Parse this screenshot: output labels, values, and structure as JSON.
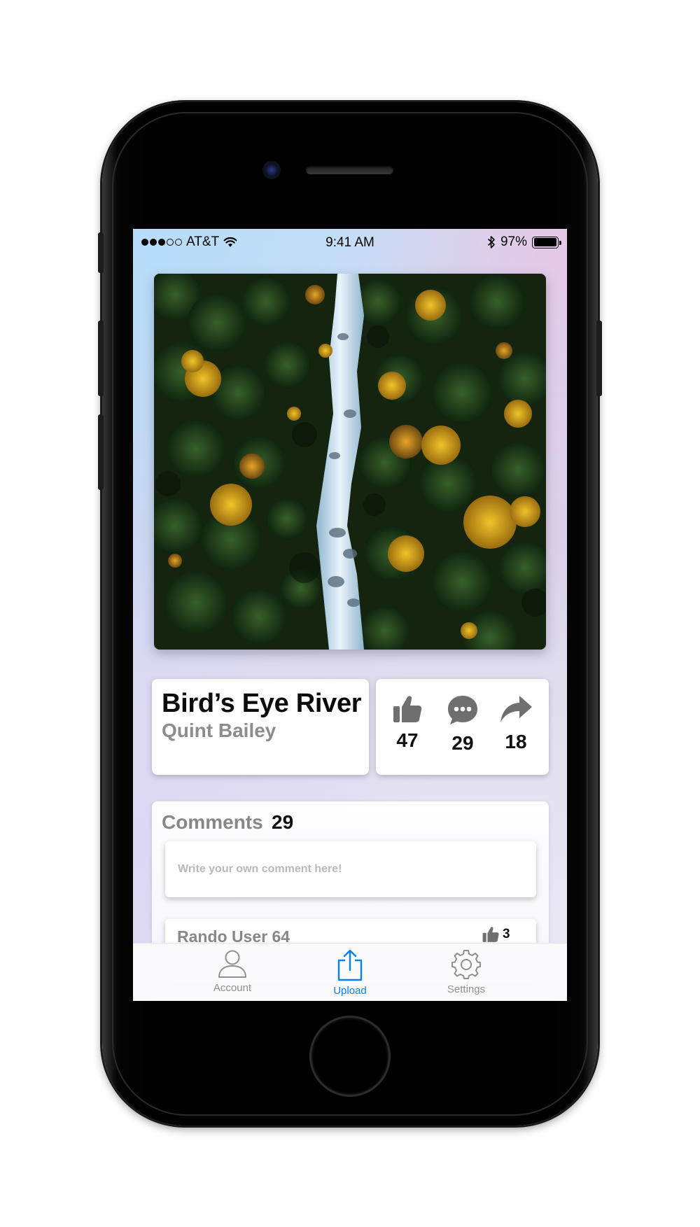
{
  "status_bar": {
    "carrier": "AT&T",
    "signal_bars": 3,
    "time": "9:41 AM",
    "battery_percent": "97%",
    "battery_level": 0.97
  },
  "photo": {
    "title": "Bird’s Eye River",
    "author": "Quint Bailey"
  },
  "stats": {
    "likes": "47",
    "comments": "29",
    "shares": "18"
  },
  "comments": {
    "label": "Comments",
    "count": "29",
    "input_placeholder": "Write your own comment here!",
    "items": [
      {
        "user": "Rando User 64",
        "likes": "3"
      }
    ]
  },
  "tab_bar": {
    "items": [
      {
        "label": "Account",
        "icon": "person-icon"
      },
      {
        "label": "Upload",
        "icon": "upload-icon"
      },
      {
        "label": "Settings",
        "icon": "gear-icon"
      }
    ],
    "selected": "Upload"
  },
  "colors": {
    "accent": "#0a7ef4",
    "icon_gray": "#6f6f6f",
    "secondary_text": "#878787"
  }
}
